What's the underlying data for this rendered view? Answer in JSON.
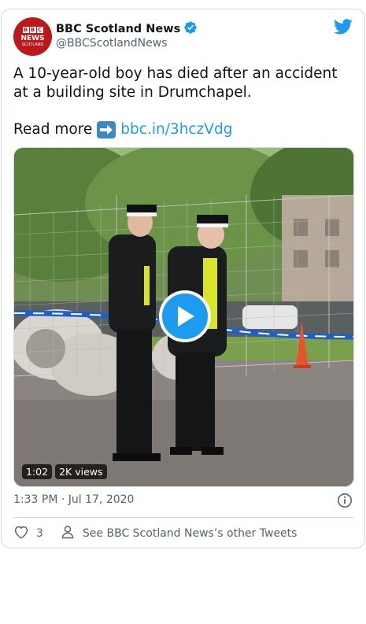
{
  "account": {
    "name": "BBC Scotland News",
    "handle": "@BBCScotlandNews",
    "avatar_text": {
      "line1": [
        "B",
        "B",
        "C"
      ],
      "line2": "NEWS",
      "line3": "SCOTLAND"
    },
    "verified": true
  },
  "tweet": {
    "text": "A 10-year-old boy has died after an accident at a building site in Drumchapel.",
    "read_more_label": "Read more",
    "link_text": "bbc.in/3hczVdg",
    "timestamp": "1:33 PM · Jul 17, 2020"
  },
  "video": {
    "duration": "1:02",
    "views": "2K views"
  },
  "actions": {
    "like_count": "3",
    "other_tweets_label": "See BBC Scotland News’s other Tweets"
  },
  "icons": {
    "bird": "twitter-bird-icon",
    "verified": "verified-badge-icon",
    "info": "info-icon",
    "heart": "heart-icon",
    "person": "person-icon",
    "play": "play-icon"
  },
  "colors": {
    "brand_blue": "#1d9bf0",
    "bbc_red": "#bb1919",
    "secondary_text": "#536471",
    "border": "#cfd9de"
  }
}
